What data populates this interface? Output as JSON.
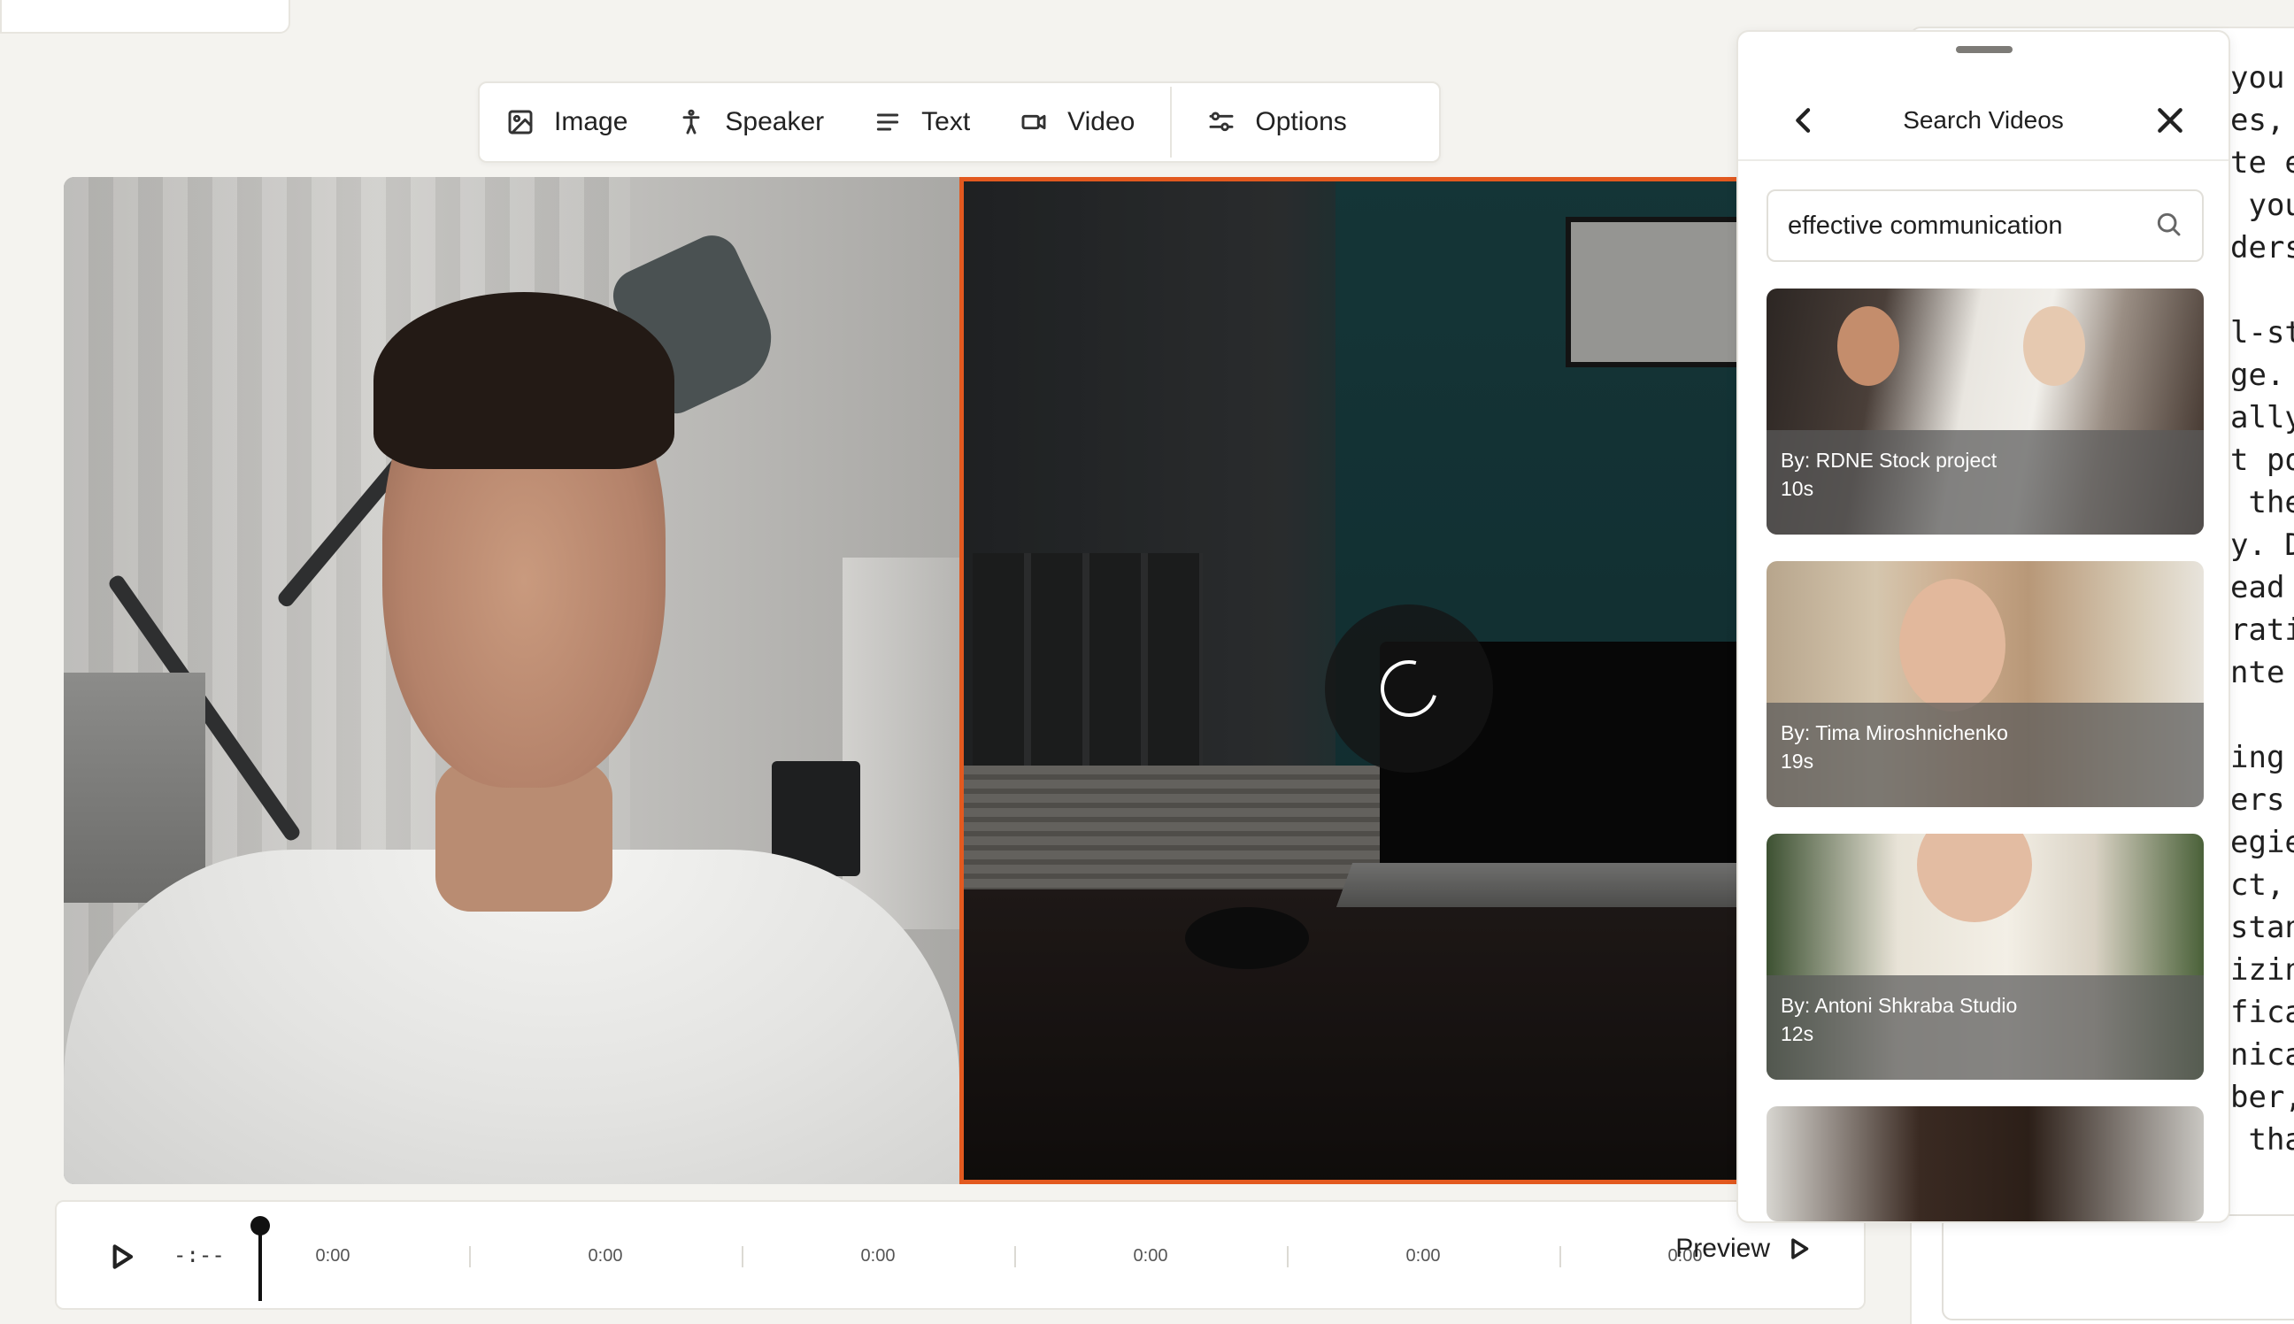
{
  "toolbar": {
    "items": [
      {
        "label": "Image",
        "icon": "image-icon"
      },
      {
        "label": "Speaker",
        "icon": "person-icon"
      },
      {
        "label": "Text",
        "icon": "text-lines-icon"
      },
      {
        "label": "Video",
        "icon": "video-camera-icon"
      }
    ],
    "options_label": "Options"
  },
  "timeline": {
    "current_time": "-:--",
    "ticks": [
      "0:00",
      "0:00",
      "0:00",
      "0:00",
      "0:00",
      "0:00"
    ],
    "preview_label": "Preview"
  },
  "drawer": {
    "title": "Search Videos",
    "search_value": "effective communication",
    "results": [
      {
        "by": "By: RDNE Stock project",
        "duration": "10s"
      },
      {
        "by": "By: Tima Miroshnichenko",
        "duration": "19s"
      },
      {
        "by": "By: Antoni Shkraba Studio",
        "duration": "12s"
      },
      {
        "by": "",
        "duration": ""
      }
    ]
  },
  "script": {
    "visible_text": "you\nes,\nte e\n you\nders\n\nl-st\nge. \nally\nt po\n the\ny. D\nead \nrati\nnte\n\ning \ners \negie\nct,\nstan\nizin\nfica\nnica\nber,\n tha"
  },
  "colors": {
    "accent": "#e2591f",
    "background": "#f4f3ef"
  }
}
